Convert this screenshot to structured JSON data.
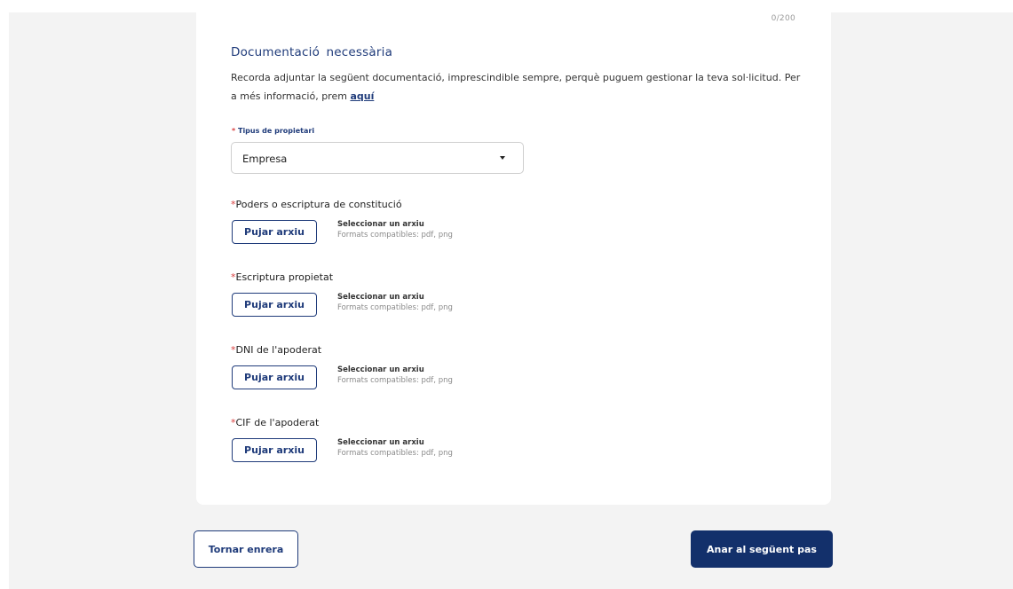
{
  "form": {
    "char_counter": "0/200",
    "section_title": "Documentació  necessària",
    "intro_text": "Recorda adjuntar la següent documentació, imprescindible sempre, perquè puguem gestionar la teva sol·licitud. Per a més informació, prem ",
    "intro_link": "aquí",
    "owner_type": {
      "required_mark": "*",
      "label": "Tipus de propietari",
      "value": "Empresa"
    },
    "documents": [
      {
        "required_mark": "*",
        "title": "Poders o escriptura de constitució",
        "button_label": "Pujar arxiu",
        "select_text": "Seleccionar un arxiu",
        "formats_text": "Formats compatibles: pdf, png"
      },
      {
        "required_mark": "*",
        "title": "Escriptura propietat",
        "button_label": "Pujar arxiu",
        "select_text": "Seleccionar un arxiu",
        "formats_text": "Formats compatibles: pdf, png"
      },
      {
        "required_mark": "*",
        "title": "DNI de l'apoderat",
        "button_label": "Pujar arxiu",
        "select_text": "Seleccionar un arxiu",
        "formats_text": "Formats compatibles: pdf, png"
      },
      {
        "required_mark": "*",
        "title": "CIF de l'apoderat",
        "button_label": "Pujar arxiu",
        "select_text": "Seleccionar un arxiu",
        "formats_text": "Formats compatibles: pdf, png"
      }
    ]
  },
  "footer": {
    "back_label": "Tornar enrera",
    "next_label": "Anar al següent pas"
  },
  "colors": {
    "primary": "#13306b",
    "accent_text": "#1f3b7a",
    "required": "#d94040",
    "page_background": "#f3f3f3",
    "card_background": "#ffffff"
  },
  "icons": {
    "dropdown": "caret-down-icon"
  }
}
